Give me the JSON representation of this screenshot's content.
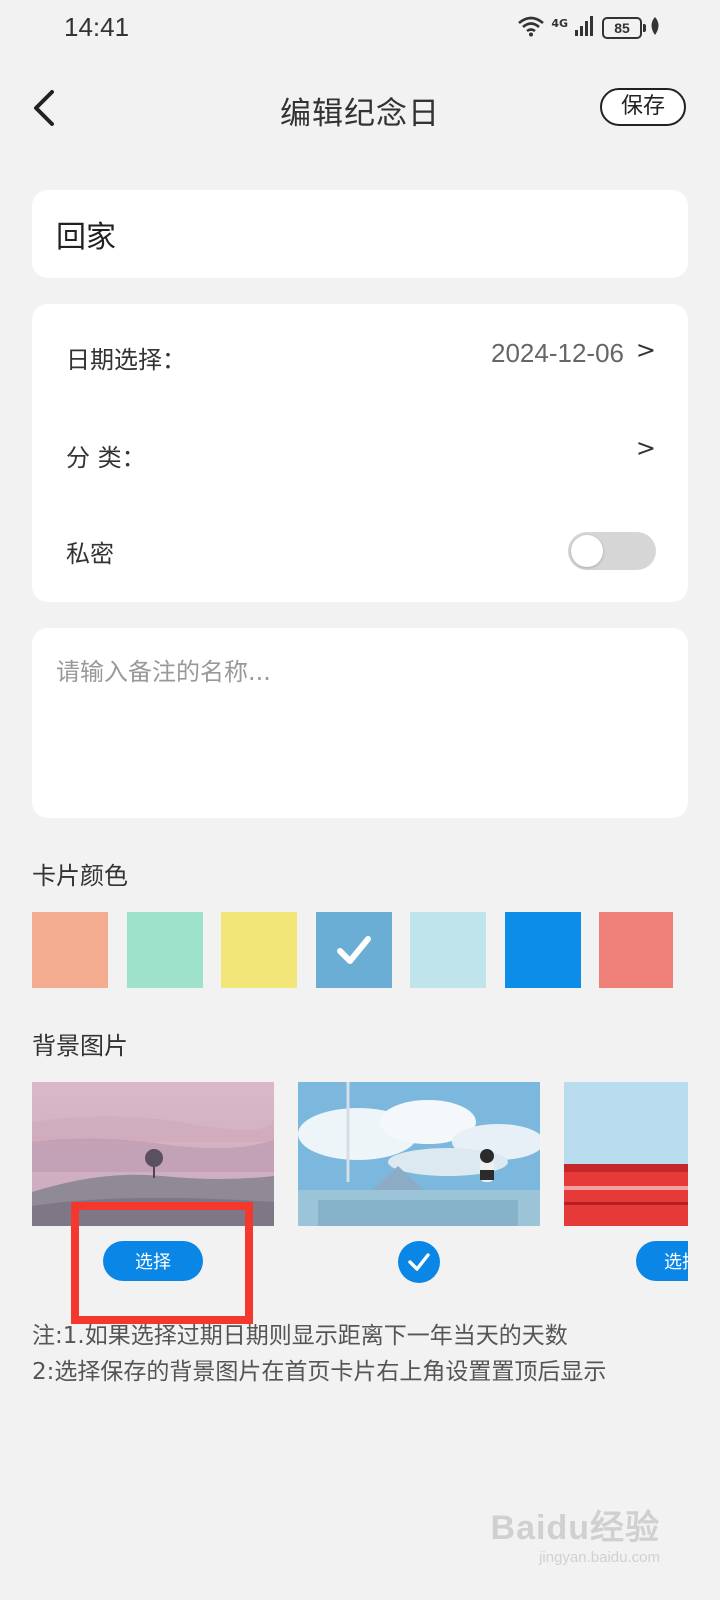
{
  "status_bar": {
    "time": "14:41",
    "network": "4G",
    "battery": "85",
    "icons": [
      "wifi-icon",
      "signal-icon",
      "battery-icon",
      "leaf-icon"
    ]
  },
  "header": {
    "title": "编辑纪念日",
    "save_label": "保存",
    "back_icon": "chevron-left-icon"
  },
  "name_field": {
    "value": "回家"
  },
  "settings": {
    "date_label": "日期选择：",
    "date_value": "2024-12-06",
    "category_label": "分 类：",
    "category_value": "",
    "private_label": "私密",
    "private_on": false,
    "arrow": ">"
  },
  "note_field": {
    "placeholder": "请输入备注的名称...",
    "value": ""
  },
  "card_color": {
    "label": "卡片颜色",
    "colors": [
      "#f3ac8f",
      "#9ee2cc",
      "#f2e679",
      "#6aaed6",
      "#bfe4ec",
      "#0b8de8",
      "#ee8078"
    ],
    "selected_index": 3
  },
  "background": {
    "label": "背景图片",
    "select_label": "选择",
    "selected_index": 1,
    "thumbs": [
      "pink-landscape-tree",
      "sky-clouds-cat",
      "red-train-sky"
    ]
  },
  "notes": {
    "line1": "注:1.如果选择过期日期则显示距离下一年当天的天数",
    "line2": "2:选择保存的背景图片在首页卡片右上角设置置顶后显示"
  },
  "watermark": {
    "logo": "Baidu经验",
    "url": "jingyan.baidu.com"
  },
  "accent_color": "#0a86e6",
  "highlight_color": "#f4382e"
}
